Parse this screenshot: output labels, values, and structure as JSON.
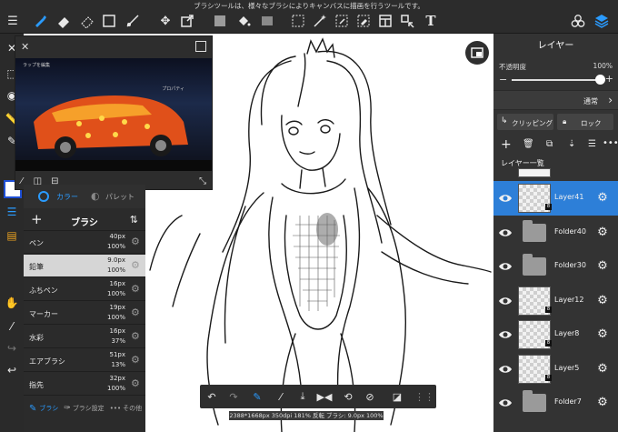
{
  "top_bar": {
    "tip_text": "ブラシツールは、様々なブラシによりキャンバスに描画を行うツールです。",
    "text_tool_glyph": "T"
  },
  "reference": {
    "caption_line1": "ラップを編集",
    "caption_line2": "プロパティ"
  },
  "palette": {
    "color_tab": "カラー",
    "palette_tab": "パレット"
  },
  "brush_panel": {
    "title": "ブラシ",
    "add_glyph": "+",
    "items": [
      {
        "name": "ペン",
        "size": "40px",
        "opacity": "100%"
      },
      {
        "name": "鉛筆",
        "size": "9.0px",
        "opacity": "100%"
      },
      {
        "name": "ふちペン",
        "size": "16px",
        "opacity": "100%"
      },
      {
        "name": "マーカー",
        "size": "19px",
        "opacity": "100%"
      },
      {
        "name": "水彩",
        "size": "16px",
        "opacity": "37%"
      },
      {
        "name": "エアブラシ",
        "size": "51px",
        "opacity": "13%"
      },
      {
        "name": "指先",
        "size": "32px",
        "opacity": "100%"
      }
    ],
    "selected_index": 1,
    "footer": {
      "brush_tab": "ブラシ",
      "settings_tab": "ブラシ設定",
      "more_tab": "その他"
    }
  },
  "layer_panel": {
    "title": "レイヤー",
    "opacity_label": "不透明度",
    "opacity_value": "100%",
    "opacity_fraction": 1.0,
    "blend_mode": "通常",
    "clipping_label": "クリッピング",
    "lock_label": "ロック",
    "list_title": "レイヤー一覧",
    "layers": [
      {
        "name": "Layer41",
        "type": "layer",
        "selected": true,
        "badge": "8"
      },
      {
        "name": "Folder40",
        "type": "folder",
        "selected": false
      },
      {
        "name": "Folder30",
        "type": "folder",
        "selected": false
      },
      {
        "name": "Layer12",
        "type": "layer",
        "selected": false,
        "badge": "8"
      },
      {
        "name": "Layer8",
        "type": "layer",
        "selected": false,
        "badge": "8"
      },
      {
        "name": "Layer5",
        "type": "layer",
        "selected": false,
        "badge": "8"
      },
      {
        "name": "Folder7",
        "type": "folder",
        "selected": false
      }
    ]
  },
  "status_bar": {
    "text": "2388*1668px 350dpi 181% 反転 ブラシ: 9.0px 100%"
  },
  "colors": {
    "accent": "#2a9bff",
    "selected_layer": "#2d7fd8",
    "panel_bg": "#2b2b2b"
  }
}
